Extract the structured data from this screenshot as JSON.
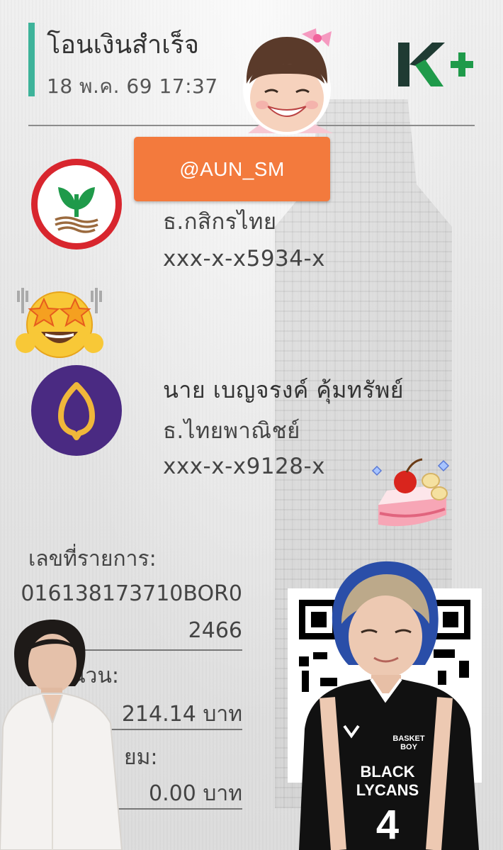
{
  "header": {
    "title": "โอนเงินสำเร็จ",
    "datetime": "18 พ.ค. 69  17:37",
    "logo_icon": "kplus-logo",
    "logo_text": "K+"
  },
  "watermark_tag": "@AUN_SM",
  "sender": {
    "bank_icon": "kasikorn-bank-logo",
    "bank": "ธ.กสิกรไทย",
    "account": "xxx-x-x5934-x"
  },
  "receiver": {
    "bank_icon": "scb-bank-logo",
    "name": "นาย เบญจรงค์ คุ้มทรัพย์",
    "bank": "ธ.ไทยพาณิชย์",
    "account": "xxx-x-x9128-x"
  },
  "transaction": {
    "ref_label": "เลขที่รายการ:",
    "ref_line1": "016138173710BOR0",
    "ref_line2": "2466",
    "amount_label_partial": "นวน:",
    "amount_value": "214.14 บาท",
    "fee_label_partial": "ยม:",
    "fee_value": "0.00 บาท"
  },
  "jersey": {
    "team_line1": "BLACK",
    "team_line2": "LYCANS",
    "badge": "BASKET BOY",
    "number": "4"
  },
  "colors": {
    "accent": "#3eb39a",
    "kbank_red": "#d8262e",
    "kbank_green": "#1f9a4a",
    "scb_purple": "#4a2a82",
    "scb_gold": "#f0b73a",
    "tag_orange": "#f37a3d",
    "kplus_green": "#1f9a4a"
  }
}
